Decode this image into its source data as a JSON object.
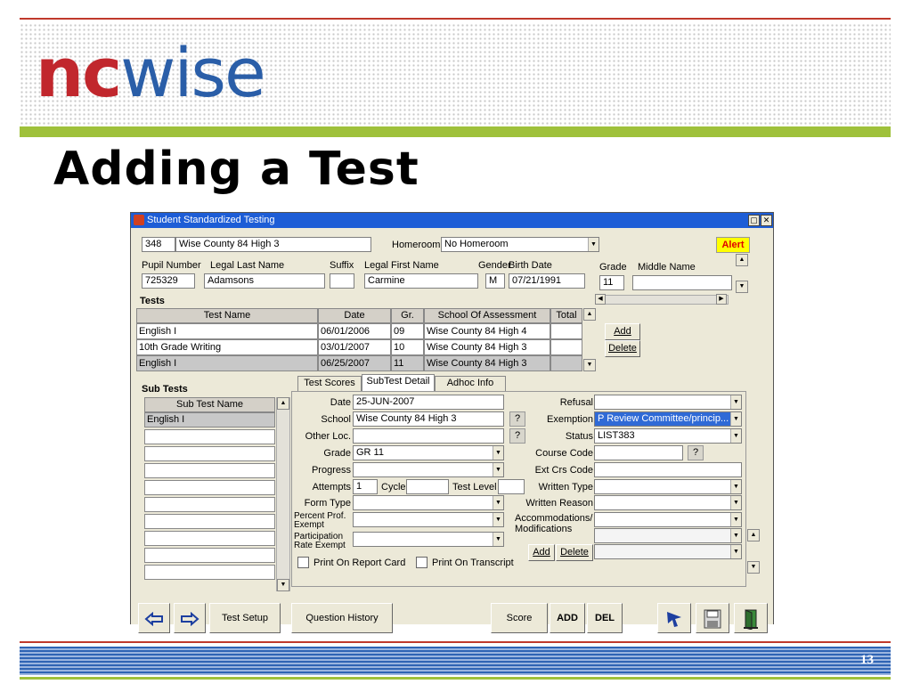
{
  "slide": {
    "logo_nc": "nc",
    "logo_wise": "wise",
    "title": "Adding a Test",
    "page_number": "13"
  },
  "window": {
    "title": "Student Standardized Testing",
    "title_buttons": [
      "▢",
      "✕"
    ]
  },
  "header": {
    "school_code": "348",
    "school_name": "Wise County 84 High 3",
    "homeroom_label": "Homeroom",
    "homeroom_value": "No Homeroom",
    "alert_label": "Alert"
  },
  "student": {
    "labels": {
      "pupil_number": "Pupil Number",
      "legal_last_name": "Legal Last Name",
      "suffix": "Suffix",
      "legal_first_name": "Legal First Name",
      "gender": "Gender",
      "birth_date": "Birth Date",
      "grade": "Grade",
      "middle_name": "Middle Name"
    },
    "values": {
      "pupil_number": "725329",
      "legal_last_name": "Adamsons",
      "suffix": "",
      "legal_first_name": "Carmine",
      "gender": "M",
      "birth_date": "07/21/1991",
      "grade": "11",
      "middle_name": ""
    }
  },
  "tests": {
    "section_label": "Tests",
    "columns": [
      "Test Name",
      "Date",
      "Gr.",
      "School Of Assessment",
      "Total"
    ],
    "rows": [
      {
        "name": "English I",
        "date": "06/01/2006",
        "grade": "09",
        "school": "Wise County 84 High 4",
        "total": ""
      },
      {
        "name": "10th Grade Writing",
        "date": "03/01/2007",
        "grade": "10",
        "school": "Wise County 84 High 3",
        "total": ""
      },
      {
        "name": "English I",
        "date": "06/25/2007",
        "grade": "11",
        "school": "Wise County 84 High 3",
        "total": ""
      }
    ],
    "add_label": "Add",
    "delete_label": "Delete"
  },
  "subtests": {
    "section_label": "Sub Tests",
    "column": "Sub Test Name",
    "rows": [
      "English I",
      "",
      "",
      "",
      "",
      "",
      "",
      "",
      "",
      ""
    ]
  },
  "tabs": [
    "Test Scores",
    "SubTest Detail",
    "Adhoc Info"
  ],
  "detail": {
    "labels": {
      "date": "Date",
      "school": "School",
      "other_loc": "Other Loc.",
      "grade": "Grade",
      "progress": "Progress",
      "attempts": "Attempts",
      "cycle": "Cycle",
      "test_level": "Test Level",
      "form_type": "Form Type",
      "percent_prof_exempt": "Percent Prof. Exempt",
      "participation_rate_exempt": "Participation Rate Exempt",
      "refusal": "Refusal",
      "exemption": "Exemption",
      "status": "Status",
      "course_code": "Course Code",
      "ext_crs_code": "Ext Crs Code",
      "written_type": "Written Type",
      "written_reason": "Written Reason",
      "accommodations": "Accommodations/ Modifications",
      "print_report_card": "Print On Report Card",
      "print_transcript": "Print On Transcript"
    },
    "values": {
      "date": "25-JUN-2007",
      "school": "Wise County 84 High 3",
      "other_loc": "",
      "grade": "GR 11",
      "progress": "",
      "attempts": "1",
      "cycle": "",
      "test_level": "",
      "form_type": "",
      "percent_prof_exempt": "",
      "participation_rate_exempt": "",
      "refusal": "",
      "exemption": "P Review Committee/princip...",
      "status": "LIST383",
      "course_code": "",
      "ext_crs_code": "",
      "written_type": "",
      "written_reason": ""
    },
    "add_label": "Add",
    "delete_label": "Delete",
    "question_mark": "?"
  },
  "toolbar": {
    "test_setup": "Test Setup",
    "question_history": "Question History",
    "score": "Score",
    "add": "ADD",
    "del": "DEL"
  },
  "colors": {
    "logo_red": "#c1272d",
    "logo_blue": "#2a5ea8",
    "accent_green": "#9fc13b",
    "titlebar_blue": "#1d5dd6",
    "selection_blue": "#2f6ad6"
  }
}
